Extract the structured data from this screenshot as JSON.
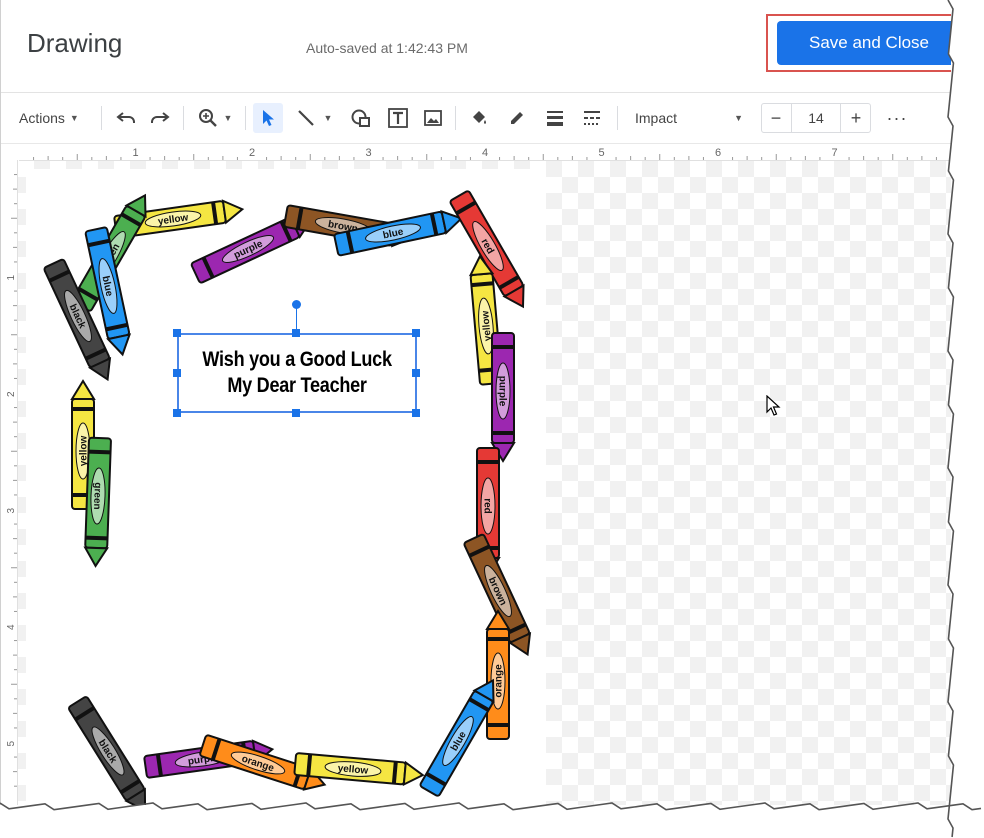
{
  "header": {
    "title": "Drawing",
    "autosave": "Auto-saved at 1:42:43 PM",
    "save_label": "Save and Close"
  },
  "toolbar": {
    "actions_label": "Actions",
    "font": "Impact",
    "font_size": "14",
    "icons": [
      "undo-icon",
      "redo-icon",
      "zoom-icon",
      "select-icon",
      "line-icon",
      "shape-icon",
      "text-box-icon",
      "image-icon",
      "fill-color-icon",
      "border-color-icon",
      "border-weight-icon",
      "border-dash-icon",
      "more-icon"
    ]
  },
  "ruler": {
    "h_numbers": [
      "1",
      "2",
      "3",
      "4",
      "5",
      "6",
      "7"
    ],
    "v_numbers": [
      "1",
      "2",
      "3",
      "4",
      "5"
    ]
  },
  "canvas": {
    "textbox_lines": [
      "Wish you a Good Luck",
      "My Dear Teacher"
    ],
    "crayons": [
      {
        "label": "yellow",
        "color": "#f5e642"
      },
      {
        "label": "green",
        "color": "#4caf50"
      },
      {
        "label": "purple",
        "color": "#9c27b0"
      },
      {
        "label": "brown",
        "color": "#8d5524"
      },
      {
        "label": "blue",
        "color": "#2196f3"
      },
      {
        "label": "red",
        "color": "#e53935"
      },
      {
        "label": "yellow",
        "color": "#f5e642"
      },
      {
        "label": "purple",
        "color": "#9c27b0"
      },
      {
        "label": "black",
        "color": "#444444"
      },
      {
        "label": "blue",
        "color": "#2196f3"
      },
      {
        "label": "yellow",
        "color": "#f5e642"
      },
      {
        "label": "green",
        "color": "#4caf50"
      },
      {
        "label": "red",
        "color": "#e53935"
      },
      {
        "label": "brown",
        "color": "#8d5524"
      },
      {
        "label": "orange",
        "color": "#ff8c1a"
      },
      {
        "label": "black",
        "color": "#444444"
      },
      {
        "label": "purple",
        "color": "#9c27b0"
      },
      {
        "label": "orange",
        "color": "#ff8c1a"
      },
      {
        "label": "yellow",
        "color": "#f5e642"
      },
      {
        "label": "blue",
        "color": "#2196f3"
      }
    ]
  },
  "colors": {
    "accent": "#1a73e8",
    "highlight": "#d9534f"
  }
}
